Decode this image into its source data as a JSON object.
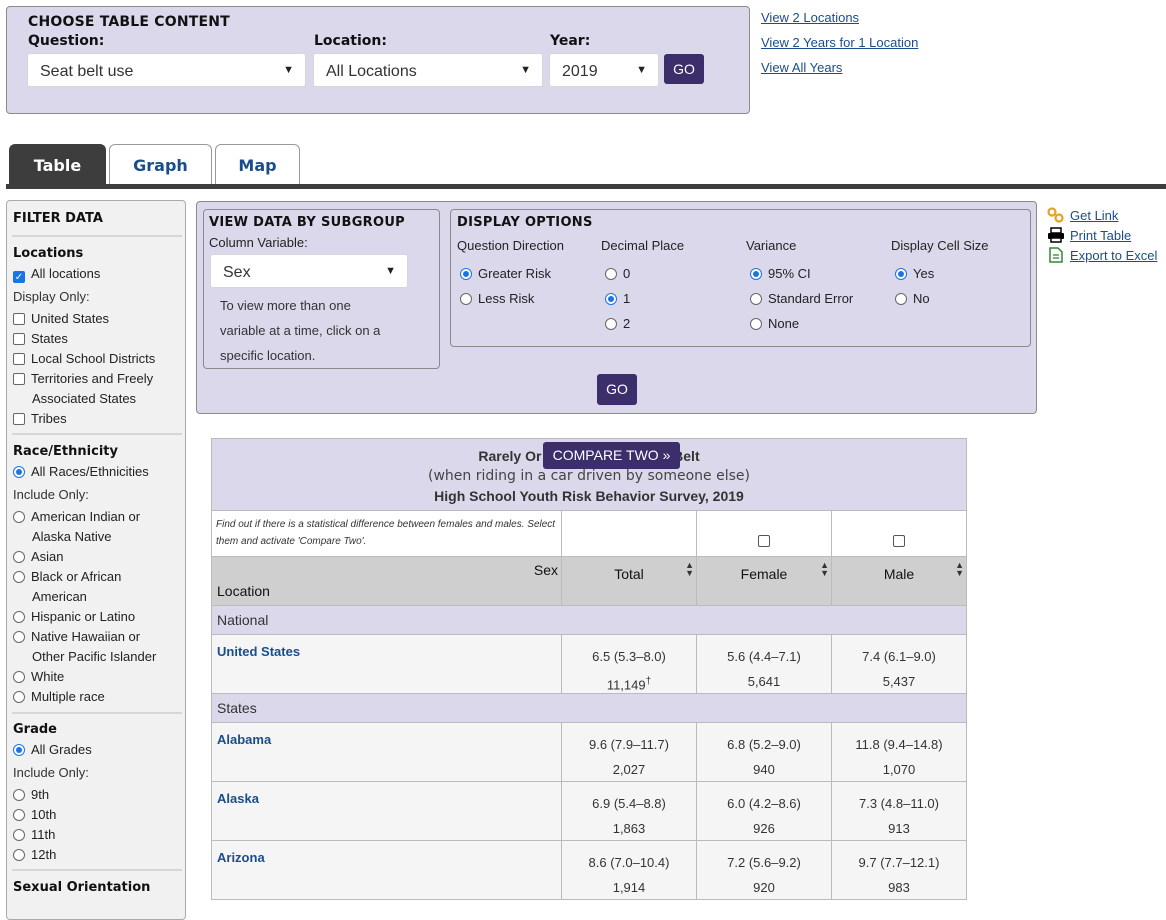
{
  "chooser": {
    "title": "CHOOSE TABLE CONTENT",
    "question_label": "Question:",
    "question_value": "Seat belt use",
    "location_label": "Location:",
    "location_value": "All Locations",
    "year_label": "Year:",
    "year_value": "2019",
    "go_label": "GO"
  },
  "top_links": [
    "View 2 Locations",
    "View 2 Years for 1 Location",
    "View All Years"
  ],
  "tabs": [
    {
      "label": "Table",
      "active": true
    },
    {
      "label": "Graph",
      "active": false
    },
    {
      "label": "Map",
      "active": false
    }
  ],
  "filter": {
    "title": "FILTER DATA",
    "locations": {
      "title": "Locations",
      "all_label": "All locations",
      "all_checked": true,
      "display_only_label": "Display Only:",
      "items": [
        "United States",
        "States",
        "Local School Districts",
        "Territories and Freely",
        "Associated States",
        "Tribes"
      ]
    },
    "race": {
      "title": "Race/Ethnicity",
      "all_label": "All Races/Ethnicities",
      "include_only_label": "Include Only:",
      "items": [
        "American Indian or",
        "Alaska Native",
        "Asian",
        "Black or African",
        "American",
        "Hispanic or Latino",
        "Native Hawaiian or",
        "Other Pacific Islander",
        "White",
        "Multiple race"
      ]
    },
    "grade": {
      "title": "Grade",
      "all_label": "All Grades",
      "include_only_label": "Include Only:",
      "items": [
        "9th",
        "10th",
        "11th",
        "12th"
      ]
    },
    "sexual_orientation": {
      "title": "Sexual Orientation"
    }
  },
  "subgroup": {
    "title": "VIEW DATA BY SUBGROUP",
    "column_variable_label": "Column Variable:",
    "column_variable_value": "Sex",
    "note_lines": [
      "To view more than one",
      "variable at a time, click on a",
      "specific location."
    ]
  },
  "display_options": {
    "title": "DISPLAY OPTIONS",
    "question_direction": {
      "label": "Question Direction",
      "options": [
        "Greater Risk",
        "Less Risk"
      ],
      "selected": "Greater Risk"
    },
    "decimal_place": {
      "label": "Decimal Place",
      "options": [
        "0",
        "1",
        "2"
      ],
      "selected": "1"
    },
    "variance": {
      "label": "Variance",
      "options": [
        "95% CI",
        "Standard Error",
        "None"
      ],
      "selected": "95% CI"
    },
    "cell_size": {
      "label": "Display Cell Size",
      "options": [
        "Yes",
        "No"
      ],
      "selected": "Yes"
    },
    "go_label": "GO"
  },
  "side_links": {
    "get_link": "Get Link",
    "print": "Print Table",
    "excel": "Export to Excel"
  },
  "table": {
    "title1": "Rarely Or Never Wore A Seat Belt",
    "title2": "(when riding in a car driven by someone else)",
    "title3": "High School Youth Risk Behavior Survey, 2019",
    "compare_note": "Find out if there is a statistical difference between females and males. Select them and activate 'Compare Two'.",
    "compare_button": "COMPARE TWO »",
    "corner_sex": "Sex",
    "corner_location": "Location",
    "columns": [
      "Total",
      "Female",
      "Male"
    ],
    "groups": [
      {
        "name": "National",
        "rows": [
          {
            "location": "United States",
            "cells": [
              {
                "est": "6.5 (5.3–8.0)",
                "n": "11,149",
                "mark": "†"
              },
              {
                "est": "5.6 (4.4–7.1)",
                "n": "5,641"
              },
              {
                "est": "7.4 (6.1–9.0)",
                "n": "5,437"
              }
            ]
          }
        ]
      },
      {
        "name": "States",
        "rows": [
          {
            "location": "Alabama",
            "cells": [
              {
                "est": "9.6 (7.9–11.7)",
                "n": "2,027"
              },
              {
                "est": "6.8 (5.2–9.0)",
                "n": "940"
              },
              {
                "est": "11.8 (9.4–14.8)",
                "n": "1,070"
              }
            ]
          },
          {
            "location": "Alaska",
            "cells": [
              {
                "est": "6.9 (5.4–8.8)",
                "n": "1,863"
              },
              {
                "est": "6.0 (4.2–8.6)",
                "n": "926"
              },
              {
                "est": "7.3 (4.8–11.0)",
                "n": "913"
              }
            ]
          },
          {
            "location": "Arizona",
            "cells": [
              {
                "est": "8.6 (7.0–10.4)",
                "n": "1,914"
              },
              {
                "est": "7.2 (5.6–9.2)",
                "n": "920"
              },
              {
                "est": "9.7 (7.7–12.1)",
                "n": "983"
              }
            ]
          }
        ]
      }
    ]
  }
}
